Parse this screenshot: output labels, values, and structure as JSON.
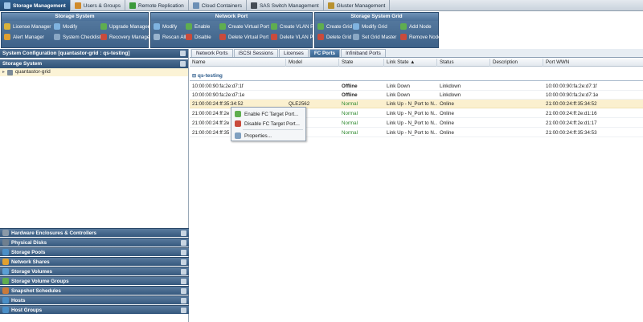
{
  "top_tabs": [
    {
      "label": "Storage Management",
      "icon": "storage-icon",
      "color": "#3d6f9f"
    },
    {
      "label": "Users & Groups",
      "icon": "users-icon",
      "color": "#d08a2a"
    },
    {
      "label": "Remote Replication",
      "icon": "replication-icon",
      "color": "#3c9a3c"
    },
    {
      "label": "Cloud Containers",
      "icon": "cloud-icon",
      "color": "#6b8fb5"
    },
    {
      "label": "SAS Switch Management",
      "icon": "switch-icon",
      "color": "#444c55"
    },
    {
      "label": "Gluster Management",
      "icon": "gluster-icon",
      "color": "#b8912f"
    }
  ],
  "ribbon": {
    "storage_system": {
      "title": "Storage System",
      "buttons": [
        {
          "label": "License Manager",
          "color": "#d9b23a"
        },
        {
          "label": "Modify",
          "color": "#7fb3e0"
        },
        {
          "label": "Upgrade Manager",
          "color": "#5fae4f"
        },
        {
          "label": "Alert Manager",
          "color": "#e0a030"
        },
        {
          "label": "System Checklist",
          "color": "#8aa7c4"
        },
        {
          "label": "Recovery Manager",
          "color": "#c94b3c"
        }
      ]
    },
    "network_port": {
      "title": "Network Port",
      "buttons": [
        {
          "label": "Modify",
          "color": "#7fb3e0"
        },
        {
          "label": "Enable",
          "color": "#5fae4f"
        },
        {
          "label": "Create Virtual Port",
          "color": "#5fae4f"
        },
        {
          "label": "Create VLAN Port",
          "color": "#5fae4f"
        },
        {
          "label": "Rescan All",
          "color": "#9ab4ce"
        },
        {
          "label": "Disable",
          "color": "#c94b3c"
        },
        {
          "label": "Delete Virtual Port",
          "color": "#c94b3c"
        },
        {
          "label": "Delete VLAN Port",
          "color": "#c94b3c"
        }
      ]
    },
    "storage_system_grid": {
      "title": "Storage System Grid",
      "buttons": [
        {
          "label": "Create Grid",
          "color": "#5fae4f"
        },
        {
          "label": "Modify Grid",
          "color": "#7fb3e0"
        },
        {
          "label": "Add Node",
          "color": "#5fae4f"
        },
        {
          "label": "Delete Grid",
          "color": "#c94b3c"
        },
        {
          "label": "Set Grid Master",
          "color": "#8aa7c4"
        },
        {
          "label": "Remove Node",
          "color": "#c94b3c"
        }
      ]
    }
  },
  "left_panel": {
    "header": "System Configuration [quantastor-grid : qs-testing]",
    "section": "Storage System",
    "tree_item": "quantastor-grid",
    "nav_sections": [
      {
        "label": "Hardware Enclosures & Controllers",
        "color": "#8b9aa8"
      },
      {
        "label": "Physical Disks",
        "color": "#6f7f8f"
      },
      {
        "label": "Storage Pools",
        "color": "#4b8fc7"
      },
      {
        "label": "Network Shares",
        "color": "#e0a030"
      },
      {
        "label": "Storage Volumes",
        "color": "#5a9fd4"
      },
      {
        "label": "Storage Volume Groups",
        "color": "#5fae4f"
      },
      {
        "label": "Snapshot Schedules",
        "color": "#c97a3a"
      },
      {
        "label": "Hosts",
        "color": "#4b8fc7"
      },
      {
        "label": "Host Groups",
        "color": "#4b8fc7"
      }
    ]
  },
  "right_panel": {
    "tabs": [
      "Network Ports",
      "iSCSI Sessions",
      "Licenses",
      "FC Ports",
      "Infiniband Ports"
    ],
    "active_tab": "FC Ports",
    "columns": [
      "Name",
      "Model",
      "State",
      "Link State ▲",
      "Status",
      "Description",
      "Port WWN"
    ],
    "group_label": "qs-testing",
    "rows": [
      {
        "name": "10:00:00:90:fa:2e:d7:1f",
        "model": "",
        "state": "Offline",
        "link_state": "Link Down",
        "status": "Linkdown",
        "description": "",
        "wwn": "10:00:00:90:fa:2e:d7:1f"
      },
      {
        "name": "10:00:00:90:fa:2e:d7:1e",
        "model": "",
        "state": "Offline",
        "link_state": "Link Down",
        "status": "Linkdown",
        "description": "",
        "wwn": "10:00:00:90:fa:2e:d7:1e"
      },
      {
        "name": "21:00:00:24:ff:35:34:52",
        "model": "QLE2562",
        "state": "Normal",
        "link_state": "Link Up - N_Port to N...",
        "status": "Online",
        "description": "",
        "wwn": "21:00:00:24:ff:35:34:52"
      },
      {
        "name": "21:00:00:24:ff:2e",
        "model": "",
        "state": "Normal",
        "link_state": "Link Up - N_Port to N...",
        "status": "Online",
        "description": "",
        "wwn": "21:00:00:24:ff:2e:d1:16"
      },
      {
        "name": "21:00:00:24:ff:2e",
        "model": "",
        "state": "Normal",
        "link_state": "Link Up - N_Port to N...",
        "status": "Online",
        "description": "",
        "wwn": "21:00:00:24:ff:2e:d1:17"
      },
      {
        "name": "21:00:00:24:ff:35",
        "model": "",
        "state": "Normal",
        "link_state": "Link Up - N_Port to N...",
        "status": "Online",
        "description": "",
        "wwn": "21:00:00:24:ff:35:34:53"
      }
    ]
  },
  "context_menu": {
    "items": [
      {
        "label": "Enable FC Target Port...",
        "icon": "enable-port-icon",
        "color": "#5fae4f"
      },
      {
        "label": "Disable FC Target Port...",
        "icon": "disable-port-icon",
        "color": "#c94b3c"
      },
      {
        "label": "Properties...",
        "icon": "properties-icon",
        "color": "#7fa0c0"
      }
    ]
  }
}
